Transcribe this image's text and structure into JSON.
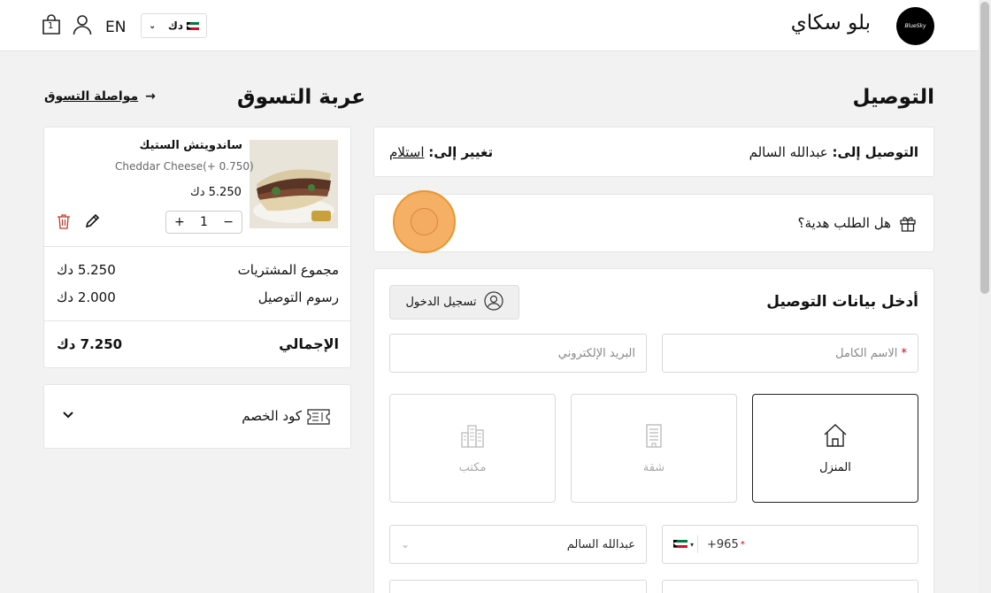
{
  "header": {
    "brand_name": "بلو سكاي",
    "logo_text": "BlueSky",
    "language": "EN",
    "currency": "دك",
    "cart_count": "1"
  },
  "delivery": {
    "title": "التوصيل",
    "deliver_to_label": "التوصيل إلى:",
    "deliver_to_value": "عبدالله السالم",
    "change_to_label": "تغيير إلى:",
    "change_to_link": "استلام",
    "gift_question": "هل الطلب هدية؟"
  },
  "delivery_form": {
    "title": "أدخل بيانات التوصيل",
    "login_button": "تسجيل الدخول",
    "full_name_placeholder": "الاسم الكامل",
    "required_mark": "*",
    "email_placeholder": "البريد الإلكتروني",
    "address_types": [
      {
        "label": "المنزل",
        "icon": "home-icon",
        "active": true
      },
      {
        "label": "شقة",
        "icon": "building-icon",
        "active": false
      },
      {
        "label": "مكتب",
        "icon": "office-icon",
        "active": false
      }
    ],
    "phone_prefix": "+965",
    "area_value": "عبدالله السالم"
  },
  "cart": {
    "title": "عربة التسوق",
    "continue_shopping": "مواصلة التسوق",
    "continue_arrow": "→",
    "item": {
      "name": "ساندويتش الستيك",
      "option": "Cheddar Cheese(+ 0.750)",
      "price": "5.250 دك",
      "quantity": "1",
      "plus": "+",
      "minus": "−"
    },
    "subtotal_label": "مجموع المشتريات",
    "subtotal_value": "5.250 دك",
    "delivery_fee_label": "رسوم التوصيل",
    "delivery_fee_value": "2.000 دك",
    "total_label": "الإجمالي",
    "total_value": "7.250 دك",
    "discount_label": "كود الخصم"
  },
  "colors": {
    "accent_orange": "#f5a24a",
    "delete_red": "#c0392b",
    "required_red": "#d0021b"
  }
}
